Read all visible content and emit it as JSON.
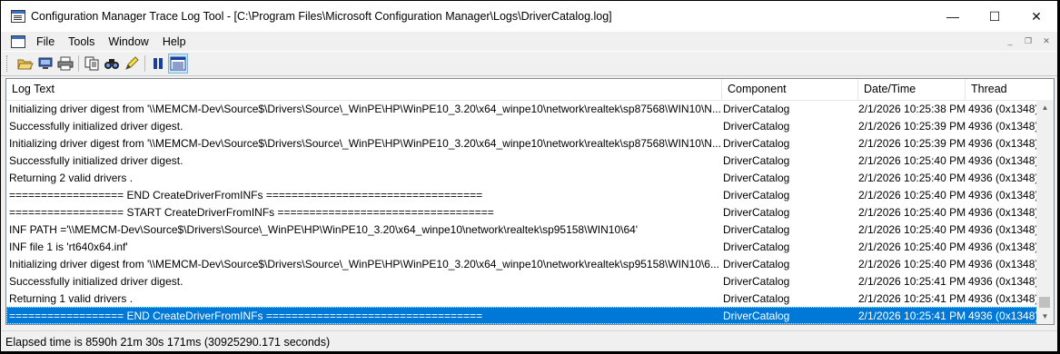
{
  "window": {
    "title": "Configuration Manager Trace Log Tool - [C:\\Program Files\\Microsoft Configuration Manager\\Logs\\DriverCatalog.log]",
    "minimize_glyph": "—",
    "maximize_glyph": "☐",
    "close_glyph": "✕"
  },
  "menu": {
    "items": [
      "File",
      "Tools",
      "Window",
      "Help"
    ],
    "mdi_minimize": "_",
    "mdi_restore": "❐",
    "mdi_close": "✕"
  },
  "toolbar": {
    "buttons": [
      "open-icon",
      "open-on-server-icon",
      "print-icon",
      "copy-icon",
      "find-icon",
      "highlight-icon",
      "pause-icon",
      "info-pane-icon"
    ]
  },
  "log": {
    "columns": [
      "Log Text",
      "Component",
      "Date/Time",
      "Thread"
    ],
    "rows": [
      {
        "text": "Initializing driver digest from '\\\\MEMCM-Dev\\Source$\\Drivers\\Source\\_WinPE\\HP\\WinPE10_3.20\\x64_winpe10\\network\\realtek\\sp87568\\WIN10\\N...",
        "component": "DriverCatalog",
        "datetime": "2/1/2026 10:25:38 PM",
        "thread": "4936 (0x1348)"
      },
      {
        "text": "Successfully initialized driver digest.",
        "component": "DriverCatalog",
        "datetime": "2/1/2026 10:25:39 PM",
        "thread": "4936 (0x1348)"
      },
      {
        "text": "Initializing driver digest from '\\\\MEMCM-Dev\\Source$\\Drivers\\Source\\_WinPE\\HP\\WinPE10_3.20\\x64_winpe10\\network\\realtek\\sp87568\\WIN10\\N...",
        "component": "DriverCatalog",
        "datetime": "2/1/2026 10:25:39 PM",
        "thread": "4936 (0x1348)"
      },
      {
        "text": "Successfully initialized driver digest.",
        "component": "DriverCatalog",
        "datetime": "2/1/2026 10:25:40 PM",
        "thread": "4936 (0x1348)"
      },
      {
        "text": "Returning 2 valid drivers .",
        "component": "DriverCatalog",
        "datetime": "2/1/2026 10:25:40 PM",
        "thread": "4936 (0x1348)"
      },
      {
        "text": "================== END CreateDriverFromINFs ==================================",
        "component": "DriverCatalog",
        "datetime": "2/1/2026 10:25:40 PM",
        "thread": "4936 (0x1348)"
      },
      {
        "text": "================== START CreateDriverFromINFs ==================================",
        "component": "DriverCatalog",
        "datetime": "2/1/2026 10:25:40 PM",
        "thread": "4936 (0x1348)"
      },
      {
        "text": "INF PATH ='\\\\MEMCM-Dev\\Source$\\Drivers\\Source\\_WinPE\\HP\\WinPE10_3.20\\x64_winpe10\\network\\realtek\\sp95158\\WIN10\\64'",
        "component": "DriverCatalog",
        "datetime": "2/1/2026 10:25:40 PM",
        "thread": "4936 (0x1348)"
      },
      {
        "text": "INF file 1 is 'rt640x64.inf'",
        "component": "DriverCatalog",
        "datetime": "2/1/2026 10:25:40 PM",
        "thread": "4936 (0x1348)"
      },
      {
        "text": "Initializing driver digest from '\\\\MEMCM-Dev\\Source$\\Drivers\\Source\\_WinPE\\HP\\WinPE10_3.20\\x64_winpe10\\network\\realtek\\sp95158\\WIN10\\6...",
        "component": "DriverCatalog",
        "datetime": "2/1/2026 10:25:40 PM",
        "thread": "4936 (0x1348)"
      },
      {
        "text": "Successfully initialized driver digest.",
        "component": "DriverCatalog",
        "datetime": "2/1/2026 10:25:41 PM",
        "thread": "4936 (0x1348)"
      },
      {
        "text": "Returning 1 valid drivers .",
        "component": "DriverCatalog",
        "datetime": "2/1/2026 10:25:41 PM",
        "thread": "4936 (0x1348)"
      },
      {
        "text": "================== END CreateDriverFromINFs ==================================",
        "component": "DriverCatalog",
        "datetime": "2/1/2026 10:25:41 PM",
        "thread": "4936 (0x1348)",
        "selected": true
      }
    ]
  },
  "status": {
    "text": "Elapsed time is 8590h 21m 30s 171ms (30925290.171 seconds)"
  },
  "colors": {
    "selection": "#0078d7",
    "accent_icon": "#3a6fc4"
  }
}
